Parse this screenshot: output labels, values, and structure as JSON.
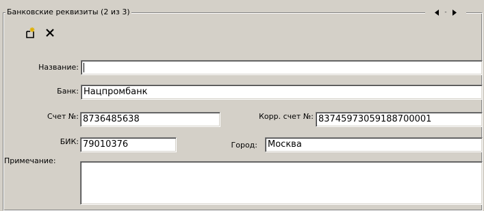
{
  "group": {
    "title": "Банковские реквизиты (2 из 3)",
    "nav_separator": "-"
  },
  "toolbar": {
    "add_icon": "new-record-icon",
    "delete_icon": "delete-x-icon"
  },
  "form": {
    "name_label": "Название:",
    "name_value": "",
    "bank_label": "Банк:",
    "bank_value": "Нацпромбанк",
    "account_label": "Счет №:",
    "account_value": "8736485638",
    "corr_account_label": "Корр. счет №:",
    "corr_account_value": "83745973059188700001",
    "bik_label": "БИК:",
    "bik_value": "79010376",
    "city_label": "Город:",
    "city_value": "Москва",
    "note_label": "Примечание:",
    "note_value": ""
  },
  "colors": {
    "panel_bg": "#d4d0c8",
    "field_bg": "#ffffff",
    "arrow": "#000000",
    "add_icon_spark": "#e0b000"
  }
}
